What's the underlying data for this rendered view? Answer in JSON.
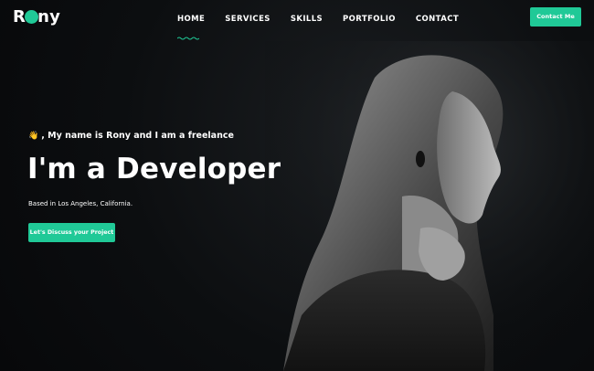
{
  "brand": {
    "logo_text_before": "R",
    "logo_text_after": "ny",
    "accent_color": "#20c997"
  },
  "nav": {
    "items": [
      {
        "label": "HOME",
        "active": true
      },
      {
        "label": "SERVICES",
        "active": false
      },
      {
        "label": "SKILLS",
        "active": false
      },
      {
        "label": "PORTFOLIO",
        "active": false
      },
      {
        "label": "CONTACT",
        "active": false
      }
    ],
    "contact_button_label": "Contact Me"
  },
  "hero": {
    "wave_icon": "waving-hand-icon",
    "wave_glyph": "👋",
    "intro_text": ", My name is Rony and I am a freelance",
    "headline": "I'm a Developer",
    "location": "Based in Los Angeles, California.",
    "cta_label": "Let's Discuss your Project"
  }
}
